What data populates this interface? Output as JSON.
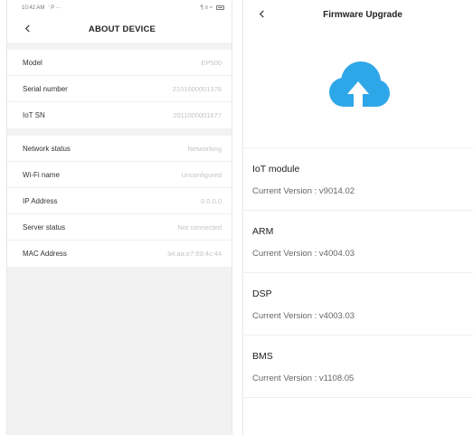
{
  "about_device": {
    "status_bar": {
      "time": "10:42 AM",
      "left_icons": "ʹ P ···",
      "right_icons": "¶ ≡ ≈"
    },
    "title": "ABOUT DEVICE",
    "group1": [
      {
        "label": "Model",
        "value": "EP500"
      },
      {
        "label": "Serial number",
        "value": "2101000001378"
      },
      {
        "label": "IoT SN",
        "value": "2011000001677"
      }
    ],
    "group2": [
      {
        "label": "Network status",
        "value": "Networking"
      },
      {
        "label": "Wi-Fi name",
        "value": "Unconfigured"
      },
      {
        "label": "IP Address",
        "value": "0.0.0.0"
      },
      {
        "label": "Server status",
        "value": "Not connected"
      },
      {
        "label": "MAC Address",
        "value": "34:aa:e7:93:4c:44"
      }
    ]
  },
  "firmware_upgrade": {
    "title": "Firmware Upgrade",
    "cloud_icon": "cloud-upload-icon",
    "cloud_color": "#2ea7e8",
    "modules": [
      {
        "name": "IoT module",
        "version": "Current Version : v9014.02"
      },
      {
        "name": "ARM",
        "version": "Current Version : v4004.03"
      },
      {
        "name": "DSP",
        "version": "Current Version : v4003.03"
      },
      {
        "name": "BMS",
        "version": "Current Version : v1108.05"
      }
    ]
  }
}
